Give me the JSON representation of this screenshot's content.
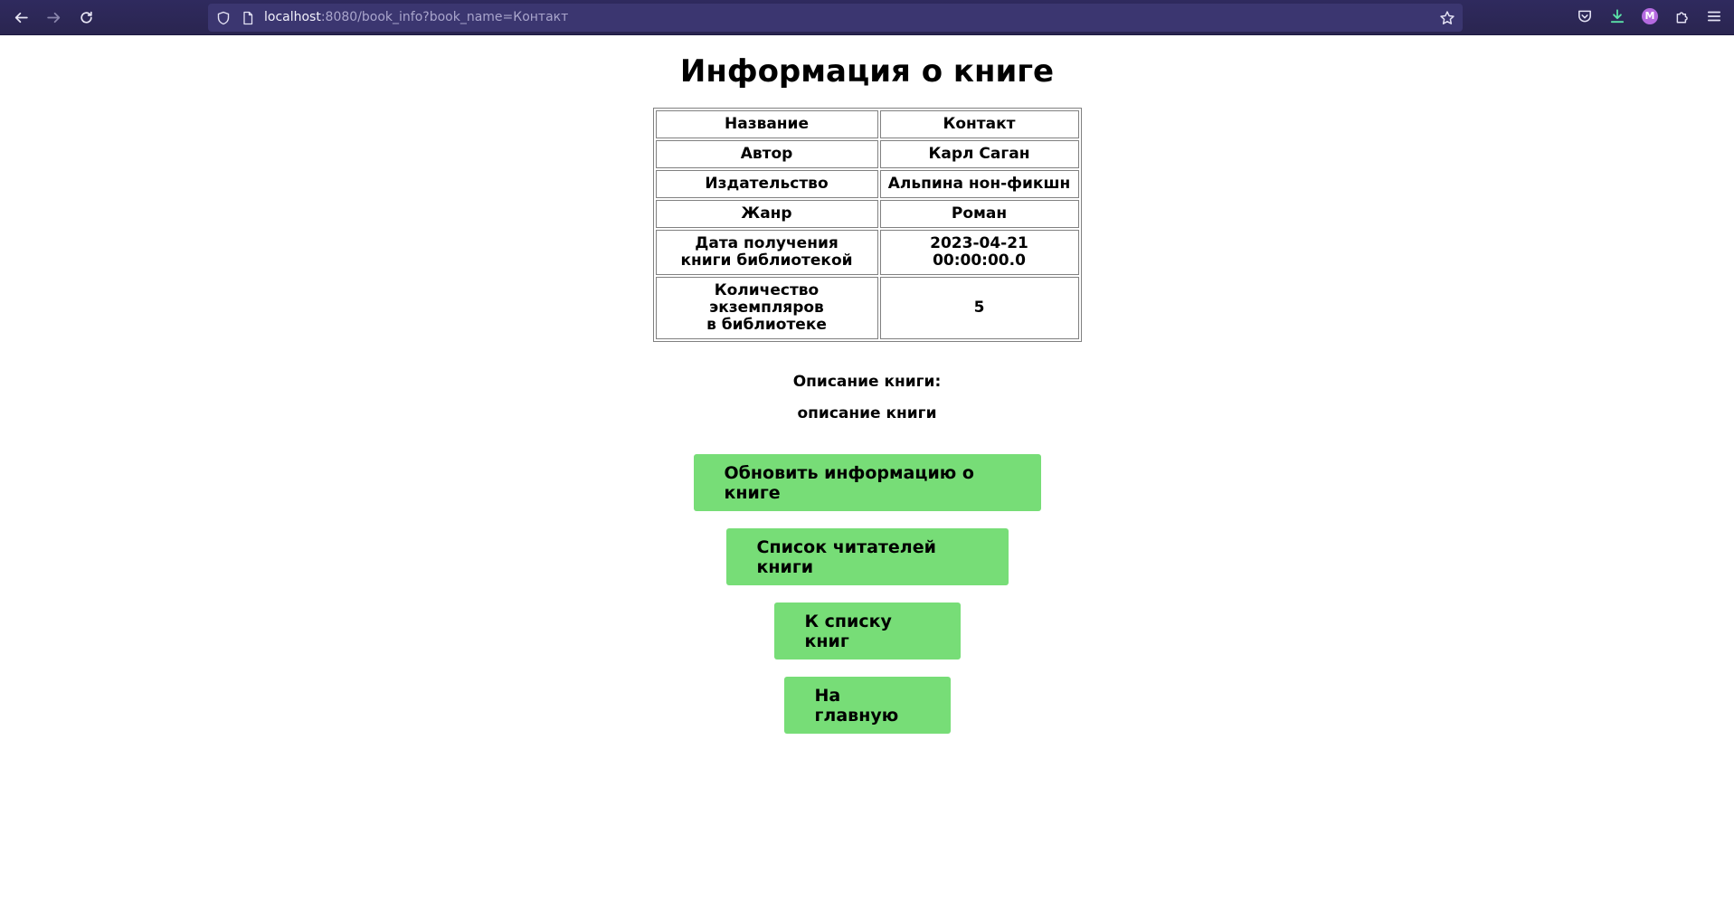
{
  "browser": {
    "url_host": "localhost",
    "url_rest": ":8080/book_info?book_name=Контакт",
    "avatar_letter": "M"
  },
  "page": {
    "title": "Информация о книге",
    "table": [
      {
        "key": "Название",
        "value": "Контакт"
      },
      {
        "key": "Автор",
        "value": "Карл Саган"
      },
      {
        "key": "Издательство",
        "value": "Альпина нон-фикшн"
      },
      {
        "key": "Жанр",
        "value": "Роман"
      },
      {
        "key_line1": "Дата получения",
        "key_line2": "книги библиотекой",
        "value": "2023-04-21 00:00:00.0"
      },
      {
        "key_line1": "Количество экземпляров",
        "key_line2": "в библиотеке",
        "value": "5"
      }
    ],
    "description_title": "Описание книги:",
    "description_text": "описание книги",
    "buttons": {
      "update": "Обновить информацию о книге",
      "readers": "Список читателей книги",
      "to_list": "К списку книг",
      "home": "На главную"
    }
  },
  "colors": {
    "button_bg": "#77dd77",
    "toolbar_bg": "#2b2a56"
  }
}
